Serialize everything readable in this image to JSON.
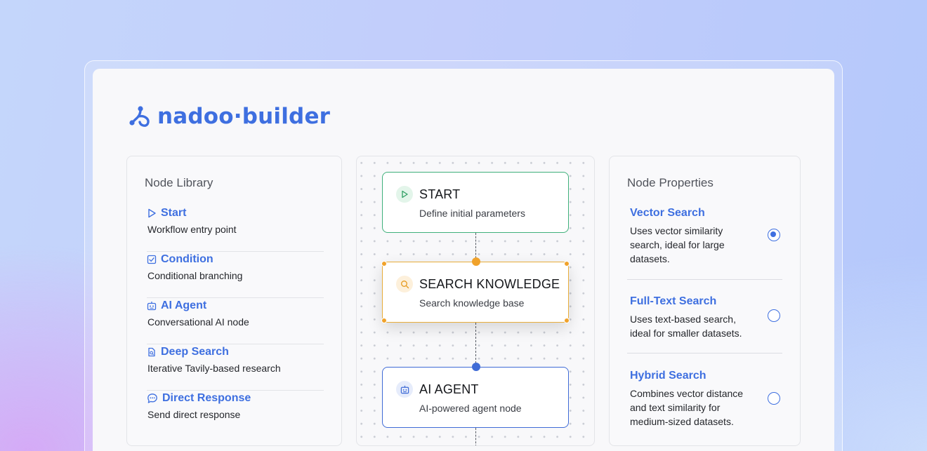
{
  "brand": {
    "name": "nadoo·builder",
    "color": "#3e6fe0"
  },
  "library": {
    "title": "Node Library",
    "items": [
      {
        "name": "Start",
        "desc": "Workflow entry point",
        "icon": "play-icon"
      },
      {
        "name": "Condition",
        "desc": "Conditional branching",
        "icon": "checkbox-icon"
      },
      {
        "name": "AI Agent",
        "desc": "Conversational AI node",
        "icon": "robot-icon"
      },
      {
        "name": "Deep Search",
        "desc": "Iterative Tavily-based research",
        "icon": "document-search-icon"
      },
      {
        "name": "Direct Response",
        "desc": "Send direct response",
        "icon": "chat-bubble-icon"
      }
    ]
  },
  "canvas": {
    "nodes": [
      {
        "title": "START",
        "desc": "Define initial parameters",
        "icon": "play-icon",
        "color": "#3fb07b"
      },
      {
        "title": "SEARCH KNOWLEDGE",
        "desc": "Search knowledge base",
        "icon": "search-icon",
        "color": "#e8ad3b"
      },
      {
        "title": "AI AGENT",
        "desc": "AI-powered agent node",
        "icon": "robot-icon",
        "color": "#3f6bd6"
      }
    ]
  },
  "properties": {
    "title": "Node Properties",
    "options": [
      {
        "name": "Vector Search",
        "desc": "Uses vector similarity search, ideal for large datasets.",
        "selected": true
      },
      {
        "name": "Full-Text Search",
        "desc": "Uses text-based search, ideal for smaller datasets.",
        "selected": false
      },
      {
        "name": "Hybrid Search",
        "desc": "Combines vector distance and text similarity for medium-sized datasets.",
        "selected": false
      }
    ]
  }
}
